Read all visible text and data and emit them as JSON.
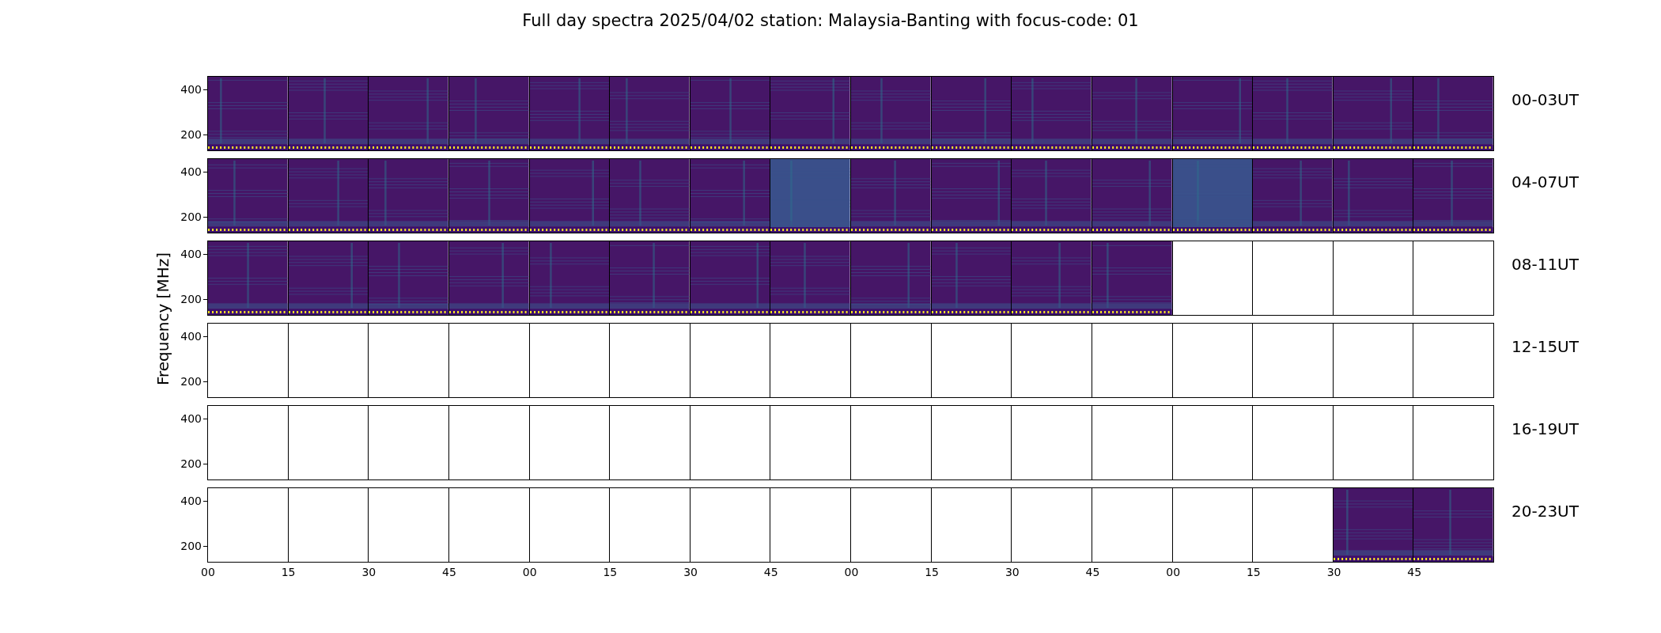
{
  "title": "Full day spectra 2025/04/02 station: Malaysia-Banting with focus-code: 01",
  "ylabel": "Frequency [MHz]",
  "rows": [
    {
      "label": "00-03UT",
      "y_ticks": [
        "400",
        "200"
      ],
      "panels": [
        {
          "kind": "spectrum"
        },
        {
          "kind": "spectrum"
        },
        {
          "kind": "spectrum"
        },
        {
          "kind": "spectrum"
        },
        {
          "kind": "spectrum"
        },
        {
          "kind": "spectrum"
        },
        {
          "kind": "spectrum"
        },
        {
          "kind": "spectrum"
        },
        {
          "kind": "spectrum"
        },
        {
          "kind": "spectrum"
        },
        {
          "kind": "spectrum"
        },
        {
          "kind": "spectrum"
        },
        {
          "kind": "spectrum"
        },
        {
          "kind": "spectrum"
        },
        {
          "kind": "spectrum"
        },
        {
          "kind": "spectrum"
        }
      ]
    },
    {
      "label": "04-07UT",
      "y_ticks": [
        "400",
        "200"
      ],
      "panels": [
        {
          "kind": "spectrum"
        },
        {
          "kind": "spectrum"
        },
        {
          "kind": "spectrum"
        },
        {
          "kind": "spectrum"
        },
        {
          "kind": "spectrum"
        },
        {
          "kind": "spectrum"
        },
        {
          "kind": "spectrum"
        },
        {
          "kind": "bright-spectrum"
        },
        {
          "kind": "spectrum"
        },
        {
          "kind": "spectrum"
        },
        {
          "kind": "spectrum"
        },
        {
          "kind": "spectrum"
        },
        {
          "kind": "bright-spectrum"
        },
        {
          "kind": "spectrum"
        },
        {
          "kind": "spectrum"
        },
        {
          "kind": "spectrum"
        }
      ]
    },
    {
      "label": "08-11UT",
      "y_ticks": [
        "400",
        "200"
      ],
      "panels": [
        {
          "kind": "spectrum"
        },
        {
          "kind": "spectrum"
        },
        {
          "kind": "spectrum"
        },
        {
          "kind": "spectrum"
        },
        {
          "kind": "spectrum"
        },
        {
          "kind": "spectrum"
        },
        {
          "kind": "spectrum"
        },
        {
          "kind": "spectrum"
        },
        {
          "kind": "spectrum"
        },
        {
          "kind": "spectrum"
        },
        {
          "kind": "spectrum"
        },
        {
          "kind": "spectrum"
        },
        {
          "kind": "empty"
        },
        {
          "kind": "empty"
        },
        {
          "kind": "empty"
        },
        {
          "kind": "empty"
        }
      ]
    },
    {
      "label": "12-15UT",
      "y_ticks": [
        "400",
        "200"
      ],
      "panels": [
        {
          "kind": "empty"
        },
        {
          "kind": "empty"
        },
        {
          "kind": "empty"
        },
        {
          "kind": "empty"
        },
        {
          "kind": "empty"
        },
        {
          "kind": "empty"
        },
        {
          "kind": "empty"
        },
        {
          "kind": "empty"
        },
        {
          "kind": "empty"
        },
        {
          "kind": "empty"
        },
        {
          "kind": "empty"
        },
        {
          "kind": "empty"
        },
        {
          "kind": "empty"
        },
        {
          "kind": "empty"
        },
        {
          "kind": "empty"
        },
        {
          "kind": "empty"
        }
      ]
    },
    {
      "label": "16-19UT",
      "y_ticks": [
        "400",
        "200"
      ],
      "panels": [
        {
          "kind": "empty"
        },
        {
          "kind": "empty"
        },
        {
          "kind": "empty"
        },
        {
          "kind": "empty"
        },
        {
          "kind": "empty"
        },
        {
          "kind": "empty"
        },
        {
          "kind": "empty"
        },
        {
          "kind": "empty"
        },
        {
          "kind": "empty"
        },
        {
          "kind": "empty"
        },
        {
          "kind": "empty"
        },
        {
          "kind": "empty"
        },
        {
          "kind": "empty"
        },
        {
          "kind": "empty"
        },
        {
          "kind": "empty"
        },
        {
          "kind": "empty"
        }
      ]
    },
    {
      "label": "20-23UT",
      "y_ticks": [
        "400",
        "200"
      ],
      "panels": [
        {
          "kind": "empty"
        },
        {
          "kind": "empty"
        },
        {
          "kind": "empty"
        },
        {
          "kind": "empty"
        },
        {
          "kind": "empty"
        },
        {
          "kind": "empty"
        },
        {
          "kind": "empty"
        },
        {
          "kind": "empty"
        },
        {
          "kind": "empty"
        },
        {
          "kind": "empty"
        },
        {
          "kind": "empty"
        },
        {
          "kind": "empty"
        },
        {
          "kind": "empty"
        },
        {
          "kind": "empty"
        },
        {
          "kind": "spectrum"
        },
        {
          "kind": "spectrum"
        }
      ]
    }
  ],
  "x_tick_labels": [
    "00",
    "15",
    "30",
    "45",
    "00",
    "15",
    "30",
    "45",
    "00",
    "15",
    "30",
    "45",
    "00",
    "15",
    "30",
    "45"
  ]
}
